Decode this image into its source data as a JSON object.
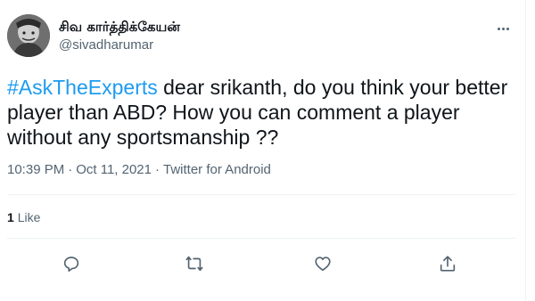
{
  "tweet": {
    "author": {
      "display_name": "சிவ கார்த்திக்கேயன்",
      "handle": "@sivadharumar"
    },
    "text_hashtag": "#AskTheExperts",
    "text_body": " dear srikanth, do you think your better player than ABD? How you can comment a player without any sportsmanship ??",
    "time": "10:39 PM",
    "date": "Oct 11, 2021",
    "source": "Twitter for Android",
    "separator": "·",
    "likes": {
      "count": "1",
      "label": "Like"
    }
  },
  "icons": {
    "more": "more-horizontal-icon",
    "reply": "reply-icon",
    "retweet": "retweet-icon",
    "like": "heart-icon",
    "share": "share-icon"
  },
  "colors": {
    "accent": "#1d9bf0",
    "text": "#0f1419",
    "secondary": "#536471",
    "border": "#eff3f4"
  }
}
